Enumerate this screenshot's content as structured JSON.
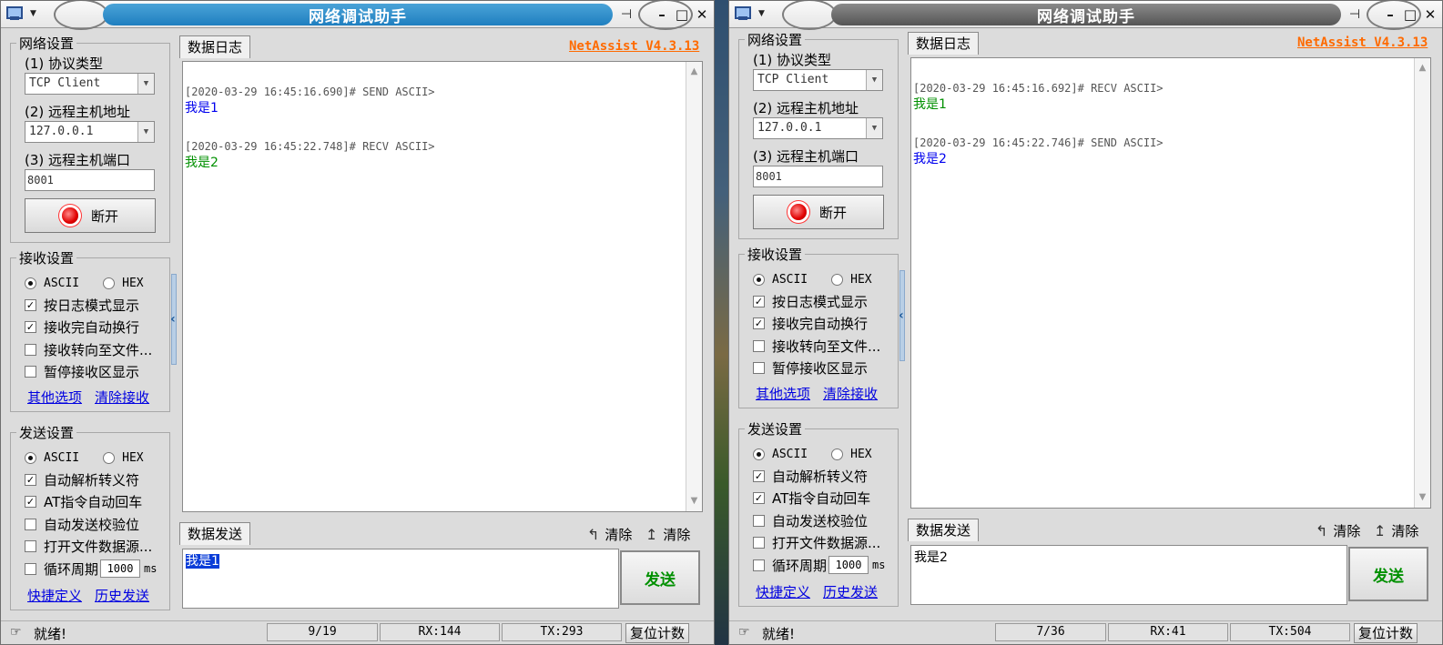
{
  "title": "网络调试助手",
  "brand": "NetAssist V4.3.13",
  "labels": {
    "network_settings": "网络设置",
    "protocol_type": "(1) 协议类型",
    "remote_host": "(2) 远程主机地址",
    "remote_port": "(3) 远程主机端口",
    "disconnect": "断开",
    "recv_settings": "接收设置",
    "send_settings": "发送设置",
    "ascii": "ASCII",
    "hex": "HEX",
    "log_mode": "按日志模式显示",
    "auto_newline": "接收完自动换行",
    "redirect_file": "接收转向至文件...",
    "pause_display": "暂停接收区显示",
    "other_options": "其他选项",
    "clear_recv": "清除接收",
    "auto_escape": "自动解析转义符",
    "at_auto_cr": "AT指令自动回车",
    "auto_checksum": "自动发送校验位",
    "open_file_source": "打开文件数据源...",
    "loop_period": "循环周期",
    "loop_ms": "1000",
    "ms": "ms",
    "shortcut": "快捷定义",
    "history_send": "历史发送",
    "data_log_tab": "数据日志",
    "data_send_tab": "数据发送",
    "clear": "清除",
    "send": "发送",
    "ready": "就绪!",
    "reset_count": "复位计数"
  },
  "windows": [
    {
      "protocol": "TCP Client",
      "host": "127.0.0.1",
      "port": "8001",
      "log": [
        {
          "head": "[2020-03-29 16:45:16.690]# SEND ASCII>",
          "body": "我是1",
          "dir": "send"
        },
        {
          "head": "[2020-03-29 16:45:22.748]# RECV ASCII>",
          "body": "我是2",
          "dir": "recv"
        }
      ],
      "send_text": "我是1",
      "status": {
        "lines": "9/19",
        "rx": "RX:144",
        "tx": "TX:293"
      }
    },
    {
      "protocol": "TCP Client",
      "host": "127.0.0.1",
      "port": "8001",
      "log": [
        {
          "head": "[2020-03-29 16:45:16.692]# RECV ASCII>",
          "body": "我是1",
          "dir": "recv"
        },
        {
          "head": "[2020-03-29 16:45:22.746]# SEND ASCII>",
          "body": "我是2",
          "dir": "send"
        }
      ],
      "send_text": "我是2",
      "status": {
        "lines": "7/36",
        "rx": "RX:41",
        "tx": "TX:504"
      }
    }
  ],
  "colors": {
    "send": "#0000ee",
    "recv": "#009000",
    "brand": "#ff6a00",
    "active_title": "#1f7fc0"
  }
}
